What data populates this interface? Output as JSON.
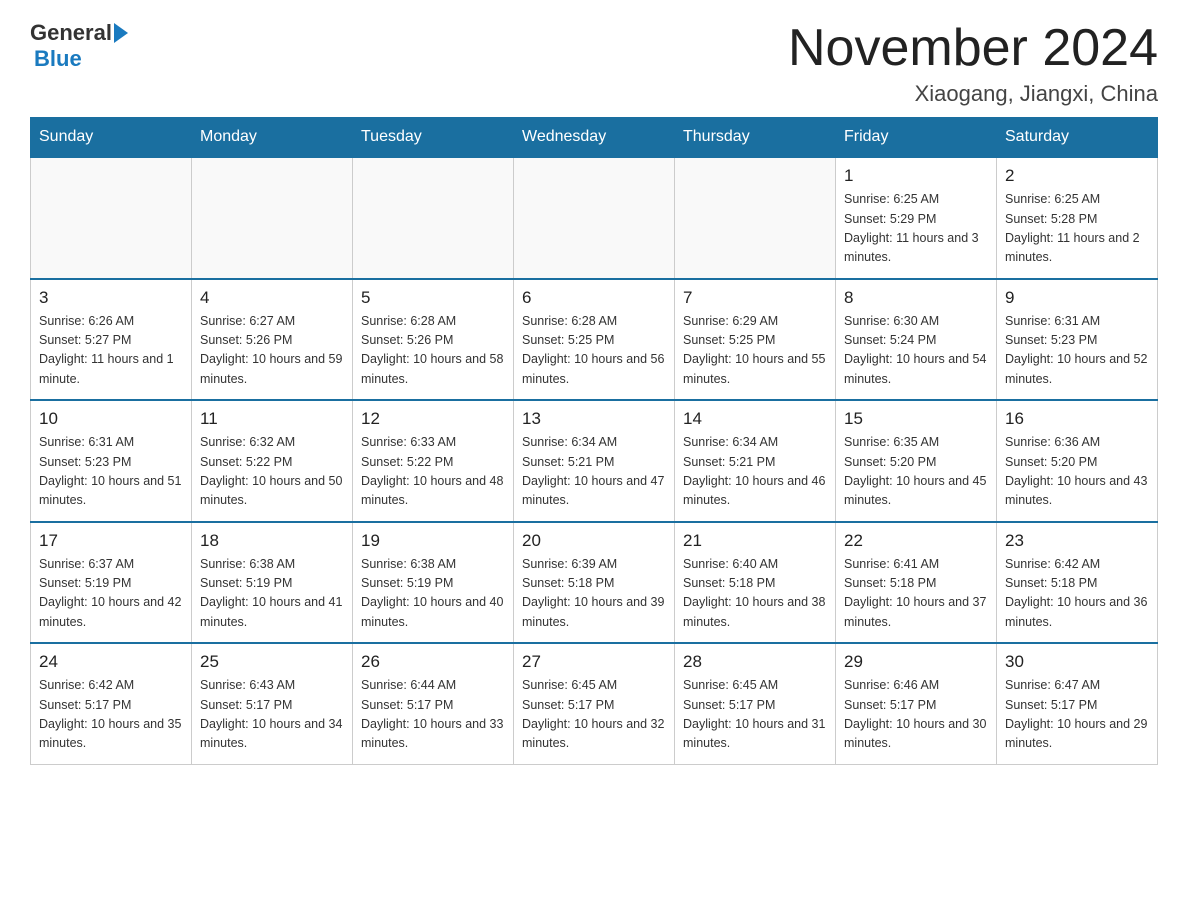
{
  "header": {
    "logo_general": "General",
    "logo_blue": "Blue",
    "month_title": "November 2024",
    "location": "Xiaogang, Jiangxi, China"
  },
  "days_of_week": [
    "Sunday",
    "Monday",
    "Tuesday",
    "Wednesday",
    "Thursday",
    "Friday",
    "Saturday"
  ],
  "weeks": [
    [
      {
        "day": "",
        "info": ""
      },
      {
        "day": "",
        "info": ""
      },
      {
        "day": "",
        "info": ""
      },
      {
        "day": "",
        "info": ""
      },
      {
        "day": "",
        "info": ""
      },
      {
        "day": "1",
        "info": "Sunrise: 6:25 AM\nSunset: 5:29 PM\nDaylight: 11 hours and 3 minutes."
      },
      {
        "day": "2",
        "info": "Sunrise: 6:25 AM\nSunset: 5:28 PM\nDaylight: 11 hours and 2 minutes."
      }
    ],
    [
      {
        "day": "3",
        "info": "Sunrise: 6:26 AM\nSunset: 5:27 PM\nDaylight: 11 hours and 1 minute."
      },
      {
        "day": "4",
        "info": "Sunrise: 6:27 AM\nSunset: 5:26 PM\nDaylight: 10 hours and 59 minutes."
      },
      {
        "day": "5",
        "info": "Sunrise: 6:28 AM\nSunset: 5:26 PM\nDaylight: 10 hours and 58 minutes."
      },
      {
        "day": "6",
        "info": "Sunrise: 6:28 AM\nSunset: 5:25 PM\nDaylight: 10 hours and 56 minutes."
      },
      {
        "day": "7",
        "info": "Sunrise: 6:29 AM\nSunset: 5:25 PM\nDaylight: 10 hours and 55 minutes."
      },
      {
        "day": "8",
        "info": "Sunrise: 6:30 AM\nSunset: 5:24 PM\nDaylight: 10 hours and 54 minutes."
      },
      {
        "day": "9",
        "info": "Sunrise: 6:31 AM\nSunset: 5:23 PM\nDaylight: 10 hours and 52 minutes."
      }
    ],
    [
      {
        "day": "10",
        "info": "Sunrise: 6:31 AM\nSunset: 5:23 PM\nDaylight: 10 hours and 51 minutes."
      },
      {
        "day": "11",
        "info": "Sunrise: 6:32 AM\nSunset: 5:22 PM\nDaylight: 10 hours and 50 minutes."
      },
      {
        "day": "12",
        "info": "Sunrise: 6:33 AM\nSunset: 5:22 PM\nDaylight: 10 hours and 48 minutes."
      },
      {
        "day": "13",
        "info": "Sunrise: 6:34 AM\nSunset: 5:21 PM\nDaylight: 10 hours and 47 minutes."
      },
      {
        "day": "14",
        "info": "Sunrise: 6:34 AM\nSunset: 5:21 PM\nDaylight: 10 hours and 46 minutes."
      },
      {
        "day": "15",
        "info": "Sunrise: 6:35 AM\nSunset: 5:20 PM\nDaylight: 10 hours and 45 minutes."
      },
      {
        "day": "16",
        "info": "Sunrise: 6:36 AM\nSunset: 5:20 PM\nDaylight: 10 hours and 43 minutes."
      }
    ],
    [
      {
        "day": "17",
        "info": "Sunrise: 6:37 AM\nSunset: 5:19 PM\nDaylight: 10 hours and 42 minutes."
      },
      {
        "day": "18",
        "info": "Sunrise: 6:38 AM\nSunset: 5:19 PM\nDaylight: 10 hours and 41 minutes."
      },
      {
        "day": "19",
        "info": "Sunrise: 6:38 AM\nSunset: 5:19 PM\nDaylight: 10 hours and 40 minutes."
      },
      {
        "day": "20",
        "info": "Sunrise: 6:39 AM\nSunset: 5:18 PM\nDaylight: 10 hours and 39 minutes."
      },
      {
        "day": "21",
        "info": "Sunrise: 6:40 AM\nSunset: 5:18 PM\nDaylight: 10 hours and 38 minutes."
      },
      {
        "day": "22",
        "info": "Sunrise: 6:41 AM\nSunset: 5:18 PM\nDaylight: 10 hours and 37 minutes."
      },
      {
        "day": "23",
        "info": "Sunrise: 6:42 AM\nSunset: 5:18 PM\nDaylight: 10 hours and 36 minutes."
      }
    ],
    [
      {
        "day": "24",
        "info": "Sunrise: 6:42 AM\nSunset: 5:17 PM\nDaylight: 10 hours and 35 minutes."
      },
      {
        "day": "25",
        "info": "Sunrise: 6:43 AM\nSunset: 5:17 PM\nDaylight: 10 hours and 34 minutes."
      },
      {
        "day": "26",
        "info": "Sunrise: 6:44 AM\nSunset: 5:17 PM\nDaylight: 10 hours and 33 minutes."
      },
      {
        "day": "27",
        "info": "Sunrise: 6:45 AM\nSunset: 5:17 PM\nDaylight: 10 hours and 32 minutes."
      },
      {
        "day": "28",
        "info": "Sunrise: 6:45 AM\nSunset: 5:17 PM\nDaylight: 10 hours and 31 minutes."
      },
      {
        "day": "29",
        "info": "Sunrise: 6:46 AM\nSunset: 5:17 PM\nDaylight: 10 hours and 30 minutes."
      },
      {
        "day": "30",
        "info": "Sunrise: 6:47 AM\nSunset: 5:17 PM\nDaylight: 10 hours and 29 minutes."
      }
    ]
  ]
}
